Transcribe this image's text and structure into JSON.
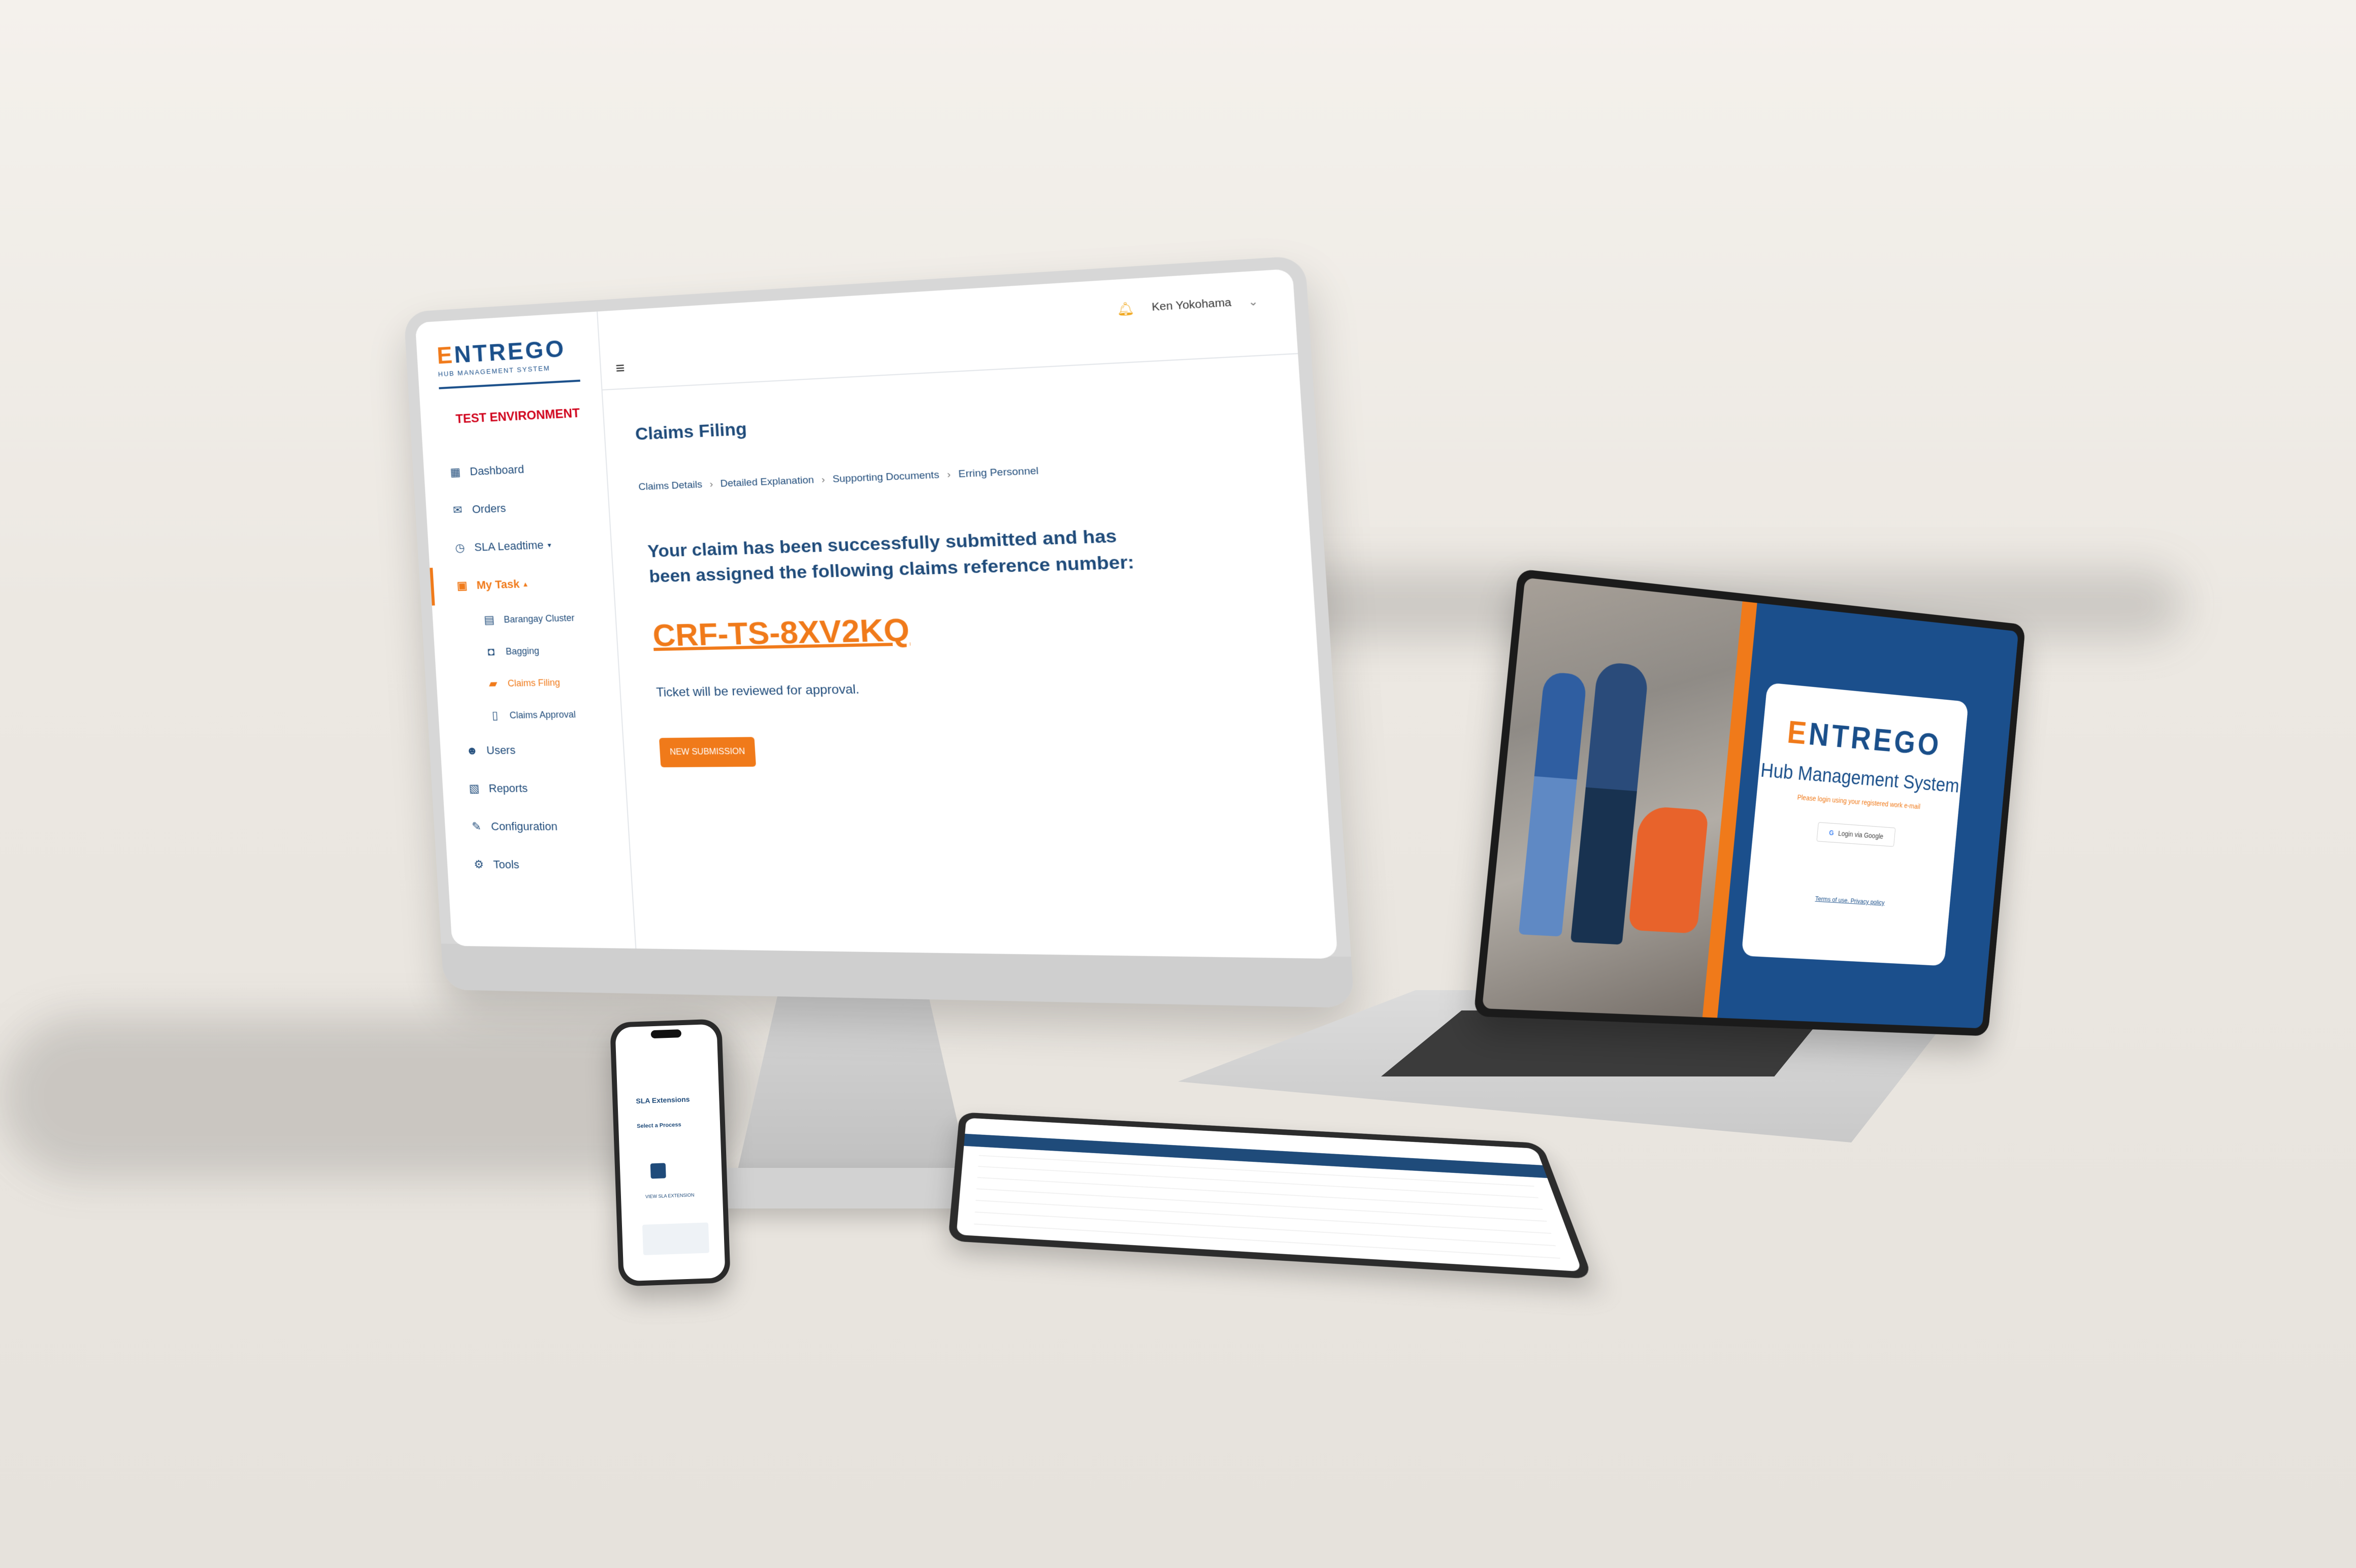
{
  "desktop": {
    "brand": {
      "logo_rest": "NTREGO",
      "logo_e": "E",
      "subtitle": "HUB MANAGEMENT SYSTEM"
    },
    "environment_label": "TEST ENVIRONMENT",
    "nav": {
      "dashboard": "Dashboard",
      "orders": "Orders",
      "sla_leadtime": "SLA Leadtime",
      "my_task": "My Task",
      "sub": {
        "barangay_cluster": "Barangay Cluster",
        "bagging": "Bagging",
        "claims_filing": "Claims Filing",
        "claims_approval": "Claims Approval"
      },
      "users": "Users",
      "reports": "Reports",
      "configuration": "Configuration",
      "tools": "Tools"
    },
    "user_name": "Ken Yokohama",
    "page_title": "Claims Filing",
    "breadcrumb": {
      "step1": "Claims Details",
      "step2": "Detailed Explanation",
      "step3": "Supporting Documents",
      "step4": "Erring Personnel"
    },
    "success_message": "Your claim has been successfully submitted and has been assigned the following claims reference number:",
    "reference_number": "CRF-TS-8XV2KQ",
    "review_message": "Ticket will be reviewed for approval.",
    "new_submission_label": "NEW SUBMISSION"
  },
  "laptop": {
    "logo_e": "E",
    "logo_rest": "NTREGO",
    "title": "Hub Management System",
    "hint": "Please login using your registered work e-mail",
    "google_button": "Login via Google",
    "terms": "Terms of use. Privacy policy"
  },
  "phone": {
    "title": "SLA Extensions",
    "subtitle": "Select a Process",
    "link": "VIEW SLA EXTENSION"
  },
  "colors": {
    "brand_blue": "#1a4f8a",
    "brand_orange": "#f07a1a",
    "test_env_red": "#d0021b"
  }
}
